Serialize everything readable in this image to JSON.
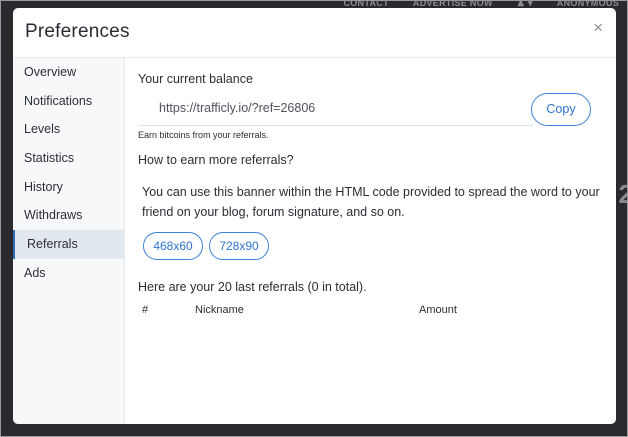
{
  "background": {
    "nav": [
      "CONTACT",
      "ADVERTISE NOW",
      "♟ ▾",
      "ANONYMOUS"
    ],
    "partial_digit": "2"
  },
  "modal": {
    "title": "Preferences",
    "close_glyph": "×"
  },
  "sidebar": {
    "items": [
      {
        "label": "Overview"
      },
      {
        "label": "Notifications"
      },
      {
        "label": "Levels"
      },
      {
        "label": "Statistics"
      },
      {
        "label": "History"
      },
      {
        "label": "Withdraws"
      },
      {
        "label": "Referrals",
        "active": true
      },
      {
        "label": "Ads"
      }
    ]
  },
  "referrals": {
    "balance_title": "Your current balance",
    "ref_link": "https://trafficly.io/?ref=26806",
    "copy_label": "Copy",
    "earn_note": "Earn bitcoins from your referrals.",
    "how_title": "How to earn more referrals?",
    "description": "You can use this banner within the HTML code provided to spread the word to your friend on your blog, forum signature, and so on.",
    "banner_sizes": [
      "468x60",
      "728x90"
    ],
    "last_referrals": "Here are your 20 last referrals (0 in total).",
    "table_headers": [
      "#",
      "Nickname",
      "Amount"
    ]
  },
  "colors": {
    "accent": "#2f74cf",
    "backdrop": "#2a2a2e",
    "sidebar_bg": "#f7f8fa",
    "active_item_bg": "#e2e8ef"
  }
}
